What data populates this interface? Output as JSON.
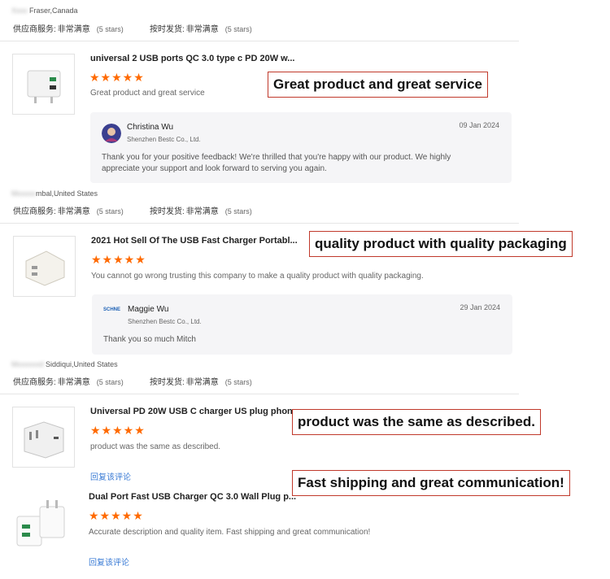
{
  "reviews": [
    {
      "buyer_visible": "Fraser,Canada",
      "supplier_label": "供应商服务:",
      "supplier_value": "非常满意",
      "supplier_stars": "(5 stars)",
      "ship_label": "按时发货:",
      "ship_value": "非常满意",
      "ship_stars": "(5 stars)"
    },
    {
      "buyer_visible": "mbal,United States",
      "product_title": "universal 2 USB ports QC 3.0 type c PD 20W w...",
      "stars": "★★★★★",
      "text": "Great product and great service",
      "callout": "Great product and great service",
      "reply_name": "Christina Wu",
      "reply_company": "Shenzhen Bestc Co., Ltd.",
      "reply_date": "09 Jan 2024",
      "reply_body": "Thank you for your positive feedback! We're thrilled that you're happy with our product. We highly appreciate your support and look forward to serving you again.",
      "supplier_label": "供应商服务:",
      "supplier_value": "非常满意",
      "supplier_stars": "(5 stars)",
      "ship_label": "按时发货:",
      "ship_value": "非常满意",
      "ship_stars": "(5 stars)"
    },
    {
      "buyer_visible": "Siddiqui,United States",
      "product_title": "2021 Hot Sell Of The USB Fast Charger Portabl...",
      "stars": "★★★★★",
      "text": "You cannot go wrong trusting this company to make a quality product with quality packaging.",
      "callout": "quality product with quality packaging",
      "reply_logo": "SCHNE",
      "reply_name": "Maggie Wu",
      "reply_company": "Shenzhen Bestc Co., Ltd.",
      "reply_date": "29 Jan 2024",
      "reply_body": "Thank you so much Mitch",
      "supplier_label": "供应商服务:",
      "supplier_value": "非常满意",
      "supplier_stars": "(5 stars)",
      "ship_label": "按时发货:",
      "ship_value": "非常满意",
      "ship_stars": "(5 stars)"
    },
    {
      "product_title": "Universal PD 20W USB C charger US plug phon...",
      "stars": "★★★★★",
      "text": "product was the same as described.",
      "callout": "product was the same as described.",
      "reply_link": "回复该评论"
    },
    {
      "product_title": "Dual Port Fast USB Charger QC 3.0 Wall Plug p...",
      "stars": "★★★★★",
      "text": "Accurate description and quality item. Fast shipping and great communication!",
      "callout": "Fast shipping and great communication!",
      "reply_link": "回复该评论"
    }
  ],
  "colors": {
    "star": "#ff6a00",
    "link": "#3a7bd5",
    "callout_border": "#c0392b",
    "reply_bg": "#f5f5f7"
  }
}
